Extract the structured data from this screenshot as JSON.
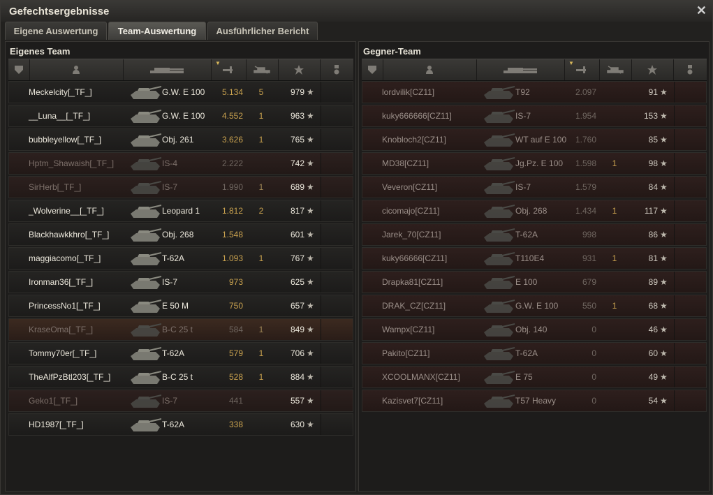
{
  "window": {
    "title": "Gefechtsergebnisse"
  },
  "tabs": [
    {
      "label": "Eigene Auswertung"
    },
    {
      "label": "Team-Auswertung"
    },
    {
      "label": "Ausführlicher Bericht"
    }
  ],
  "own_team": {
    "title": "Eigenes Team",
    "rows": [
      {
        "name": "Meckelcity[_TF_]",
        "tank": "G.W. E 100",
        "damage": "5.134",
        "kills": "5",
        "xp": "979",
        "state": "alive"
      },
      {
        "name": "__Luna__[_TF_]",
        "tank": "G.W. E 100",
        "damage": "4.552",
        "kills": "1",
        "xp": "963",
        "state": "alive"
      },
      {
        "name": "bubbleyellow[_TF_]",
        "tank": "Obj. 261",
        "damage": "3.626",
        "kills": "1",
        "xp": "765",
        "state": "alive"
      },
      {
        "name": "Hptm_Shawaish[_TF_]",
        "tank": "IS-4",
        "damage": "2.222",
        "kills": "",
        "xp": "742",
        "state": "dead"
      },
      {
        "name": "SirHerb[_TF_]",
        "tank": "IS-7",
        "damage": "1.990",
        "kills": "1",
        "xp": "689",
        "state": "dead"
      },
      {
        "name": "_Wolverine__[_TF_]",
        "tank": "Leopard 1",
        "damage": "1.812",
        "kills": "2",
        "xp": "817",
        "state": "alive"
      },
      {
        "name": "Blackhawkkhro[_TF_]",
        "tank": "Obj. 268",
        "damage": "1.548",
        "kills": "",
        "xp": "601",
        "state": "alive"
      },
      {
        "name": "maggiacomo[_TF_]",
        "tank": "T-62A",
        "damage": "1.093",
        "kills": "1",
        "xp": "767",
        "state": "alive"
      },
      {
        "name": "Ironman36[_TF_]",
        "tank": "IS-7",
        "damage": "973",
        "kills": "",
        "xp": "625",
        "state": "alive"
      },
      {
        "name": "PrincessNo1[_TF_]",
        "tank": "E 50 M",
        "damage": "750",
        "kills": "",
        "xp": "657",
        "state": "alive"
      },
      {
        "name": "KraseOma[_TF_]",
        "tank": "B-C 25 t",
        "damage": "584",
        "kills": "1",
        "xp": "849",
        "state": "self"
      },
      {
        "name": "Tommy70er[_TF_]",
        "tank": "T-62A",
        "damage": "579",
        "kills": "1",
        "xp": "706",
        "state": "alive"
      },
      {
        "name": "TheAlfPzBtl203[_TF_]",
        "tank": "B-C 25 t",
        "damage": "528",
        "kills": "1",
        "xp": "884",
        "state": "alive"
      },
      {
        "name": "Geko1[_TF_]",
        "tank": "IS-7",
        "damage": "441",
        "kills": "",
        "xp": "557",
        "state": "dead"
      },
      {
        "name": "HD1987[_TF_]",
        "tank": "T-62A",
        "damage": "338",
        "kills": "",
        "xp": "630",
        "state": "alive"
      }
    ]
  },
  "enemy_team": {
    "title": "Gegner-Team",
    "rows": [
      {
        "name": "lordvilik[CZ11]",
        "tank": "T92",
        "damage": "2.097",
        "kills": "",
        "xp": "91"
      },
      {
        "name": "kuky666666[CZ11]",
        "tank": "IS-7",
        "damage": "1.954",
        "kills": "",
        "xp": "153"
      },
      {
        "name": "Knobloch2[CZ11]",
        "tank": "WT auf E 100",
        "damage": "1.760",
        "kills": "",
        "xp": "85"
      },
      {
        "name": "MD38[CZ11]",
        "tank": "Jg.Pz. E 100",
        "damage": "1.598",
        "kills": "1",
        "xp": "98"
      },
      {
        "name": "Veveron[CZ11]",
        "tank": "IS-7",
        "damage": "1.579",
        "kills": "",
        "xp": "84"
      },
      {
        "name": "cicomajo[CZ11]",
        "tank": "Obj. 268",
        "damage": "1.434",
        "kills": "1",
        "xp": "117"
      },
      {
        "name": "Jarek_70[CZ11]",
        "tank": "T-62A",
        "damage": "998",
        "kills": "",
        "xp": "86"
      },
      {
        "name": "kuky66666[CZ11]",
        "tank": "T110E4",
        "damage": "931",
        "kills": "1",
        "xp": "81"
      },
      {
        "name": "Drapka81[CZ11]",
        "tank": "E 100",
        "damage": "679",
        "kills": "",
        "xp": "89"
      },
      {
        "name": "DRAK_CZ[CZ11]",
        "tank": "G.W. E 100",
        "damage": "550",
        "kills": "1",
        "xp": "68"
      },
      {
        "name": "Wampx[CZ11]",
        "tank": "Obj. 140",
        "damage": "0",
        "kills": "",
        "xp": "46"
      },
      {
        "name": "Pakito[CZ11]",
        "tank": "T-62A",
        "damage": "0",
        "kills": "",
        "xp": "60"
      },
      {
        "name": "XCOOLMANX[CZ11]",
        "tank": "E 75",
        "damage": "0",
        "kills": "",
        "xp": "49"
      },
      {
        "name": "Kazisvet7[CZ11]",
        "tank": "T57 Heavy",
        "damage": "0",
        "kills": "",
        "xp": "54"
      }
    ]
  },
  "icons": {
    "star": "★",
    "close": "✕"
  }
}
